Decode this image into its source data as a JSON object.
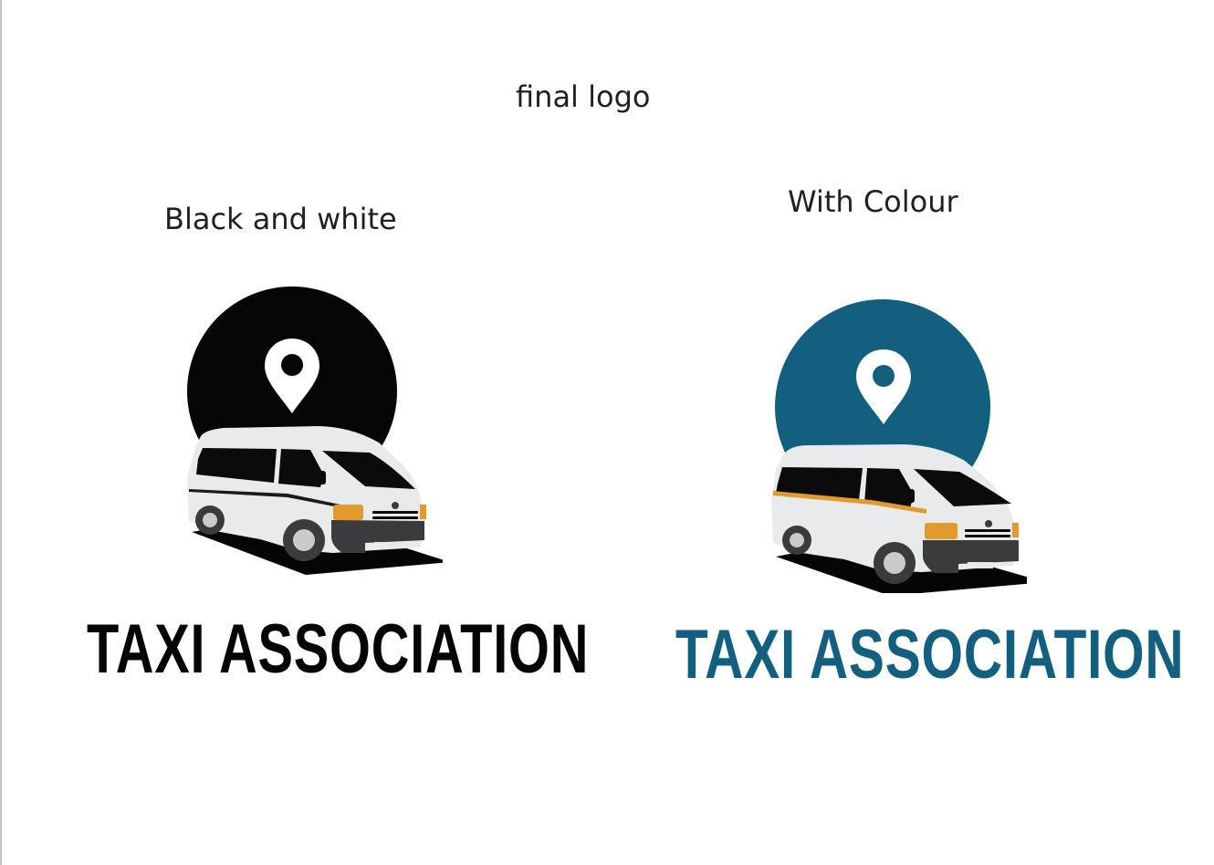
{
  "page": {
    "title": "final logo",
    "background": "#ffffff"
  },
  "variants": {
    "black_and_white": {
      "caption": "Black and white",
      "wordmark": "TAXI ASSOCIATION",
      "circle_color": "#050606",
      "wordmark_color": "#050505",
      "stripe_color": "#1a1a1a"
    },
    "colour": {
      "caption": "With Colour",
      "wordmark": "TAXI ASSOCIATION",
      "circle_color": "#125f80",
      "wordmark_color": "#125f80",
      "stripe_color": "#e39a2d"
    }
  },
  "colors": {
    "van_body": "#e9eaec",
    "van_windows": "#0b0b0c",
    "indicator": "#e39a2d",
    "bumper": "#3a3b3d",
    "shadow": "#050505",
    "pin": "#ffffff",
    "text": "#231f20"
  },
  "icons": [
    "location-pin-icon",
    "minibus-taxi-icon"
  ]
}
